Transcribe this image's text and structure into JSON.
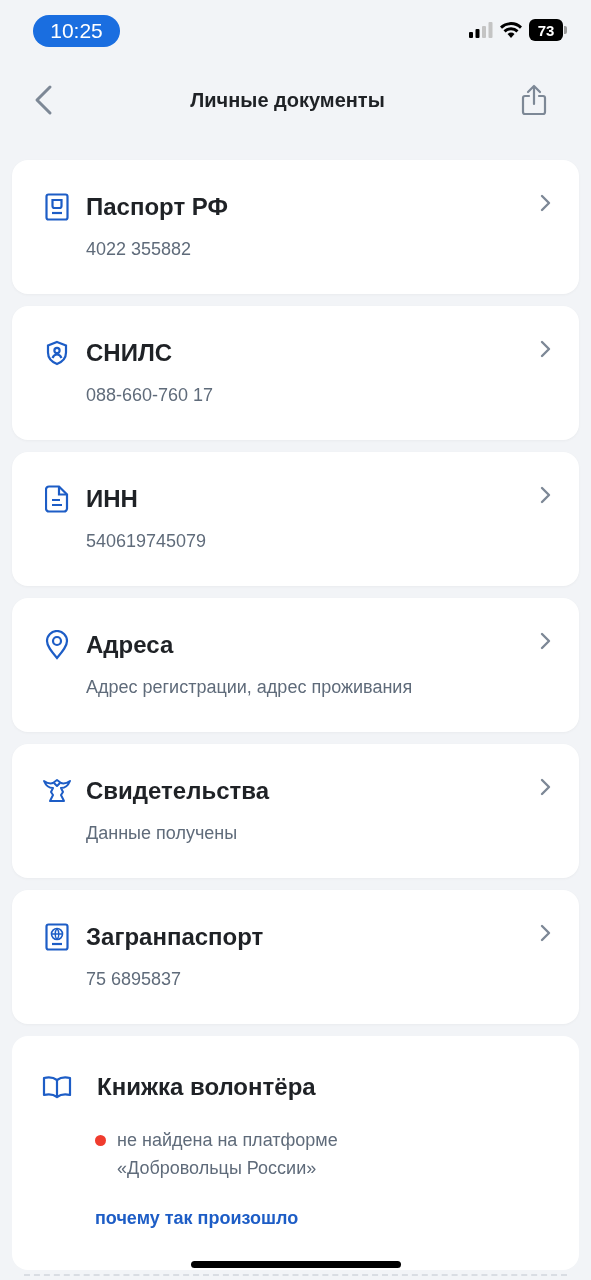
{
  "status_bar": {
    "time": "10:25",
    "battery": "73"
  },
  "header": {
    "title": "Личные документы"
  },
  "documents": [
    {
      "kind": "passport",
      "title": "Паспорт РФ",
      "subtitle": "4022 355882"
    },
    {
      "kind": "shield",
      "title": "СНИЛС",
      "subtitle": "088-660-760 17"
    },
    {
      "kind": "document",
      "title": "ИНН",
      "subtitle": "540619745079"
    },
    {
      "kind": "pin",
      "title": "Адреса",
      "subtitle": "Адрес регистрации, адрес проживания"
    },
    {
      "kind": "bird",
      "title": "Свидетельства",
      "subtitle": "Данные получены"
    },
    {
      "kind": "globe",
      "title": "Загранпаспорт",
      "subtitle": "75 6895837"
    }
  ],
  "volunteer": {
    "title": "Книжка волонтёра",
    "status": {
      "color": "#f03c2e",
      "lines": [
        "не найдена на платформе",
        "«Добровольцы России»"
      ]
    },
    "link": "почему так произошло"
  }
}
